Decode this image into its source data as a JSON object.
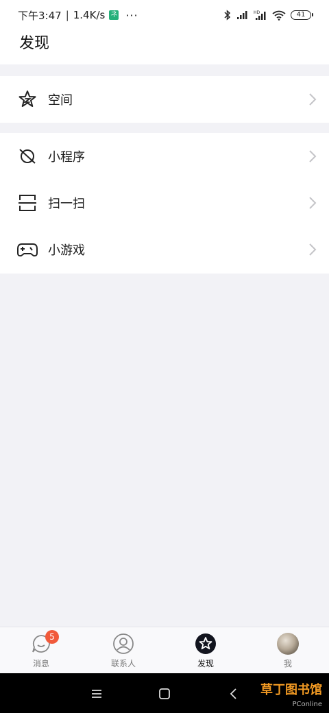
{
  "status_bar": {
    "time": "下午3:47",
    "separator": "|",
    "speed": "1.4K/s",
    "app_badge": "ネ",
    "more": "···",
    "battery": "41"
  },
  "header": {
    "title": "发现"
  },
  "groups": [
    {
      "items": [
        {
          "label": "空间",
          "icon": "star-icon"
        }
      ]
    },
    {
      "items": [
        {
          "label": "小程序",
          "icon": "planet-icon"
        },
        {
          "label": "扫一扫",
          "icon": "scan-icon"
        },
        {
          "label": "小游戏",
          "icon": "gamepad-icon"
        }
      ]
    }
  ],
  "tabs": [
    {
      "label": "消息",
      "icon": "chat-bubble-icon",
      "badge": "5"
    },
    {
      "label": "联系人",
      "icon": "contact-icon"
    },
    {
      "label": "发现",
      "icon": "discover-star-icon",
      "active": true
    },
    {
      "label": "我",
      "icon": "avatar"
    }
  ],
  "watermark": {
    "brand": "草丁图书馆",
    "sub": "PConline"
  },
  "colors": {
    "accent_badge": "#f15a3b",
    "background": "#f2f2f6"
  }
}
